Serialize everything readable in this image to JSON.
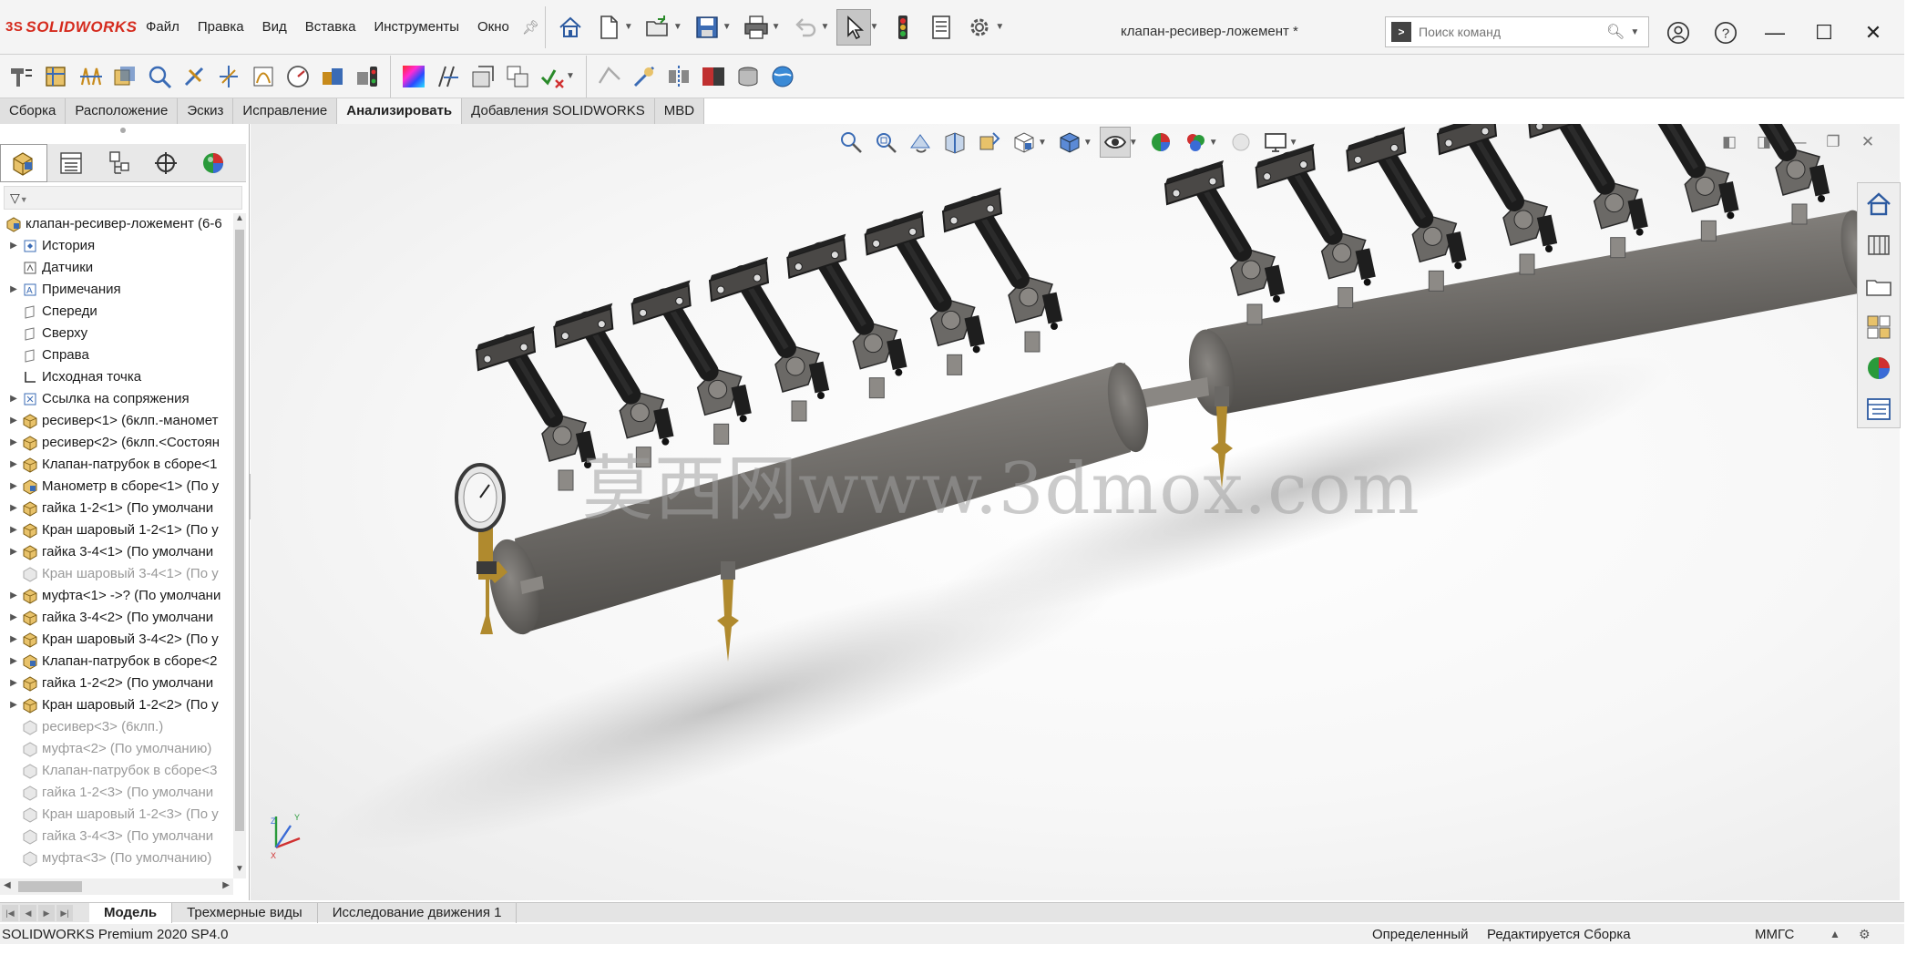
{
  "app": {
    "logo_text": "SOLIDWORKS",
    "logo_prefix": "3S",
    "document_title": "клапан-ресивер-ложемент *"
  },
  "menu": [
    "Файл",
    "Правка",
    "Вид",
    "Вставка",
    "Инструменты",
    "Окно"
  ],
  "search": {
    "placeholder": "Поиск команд"
  },
  "command_tabs": [
    {
      "label": "Сборка",
      "active": false
    },
    {
      "label": "Расположение",
      "active": false
    },
    {
      "label": "Эскиз",
      "active": false
    },
    {
      "label": "Исправление",
      "active": false
    },
    {
      "label": "Анализировать",
      "active": true
    },
    {
      "label": "Добавления SOLIDWORKS",
      "active": false
    },
    {
      "label": "MBD",
      "active": false
    }
  ],
  "feature_tree": {
    "root": "клапан-ресивер-ложемент  (6-6",
    "items": [
      {
        "label": "История",
        "icon": "history-icon",
        "expandable": true,
        "suppressed": false
      },
      {
        "label": "Датчики",
        "icon": "sensor-icon",
        "expandable": false,
        "suppressed": false
      },
      {
        "label": "Примечания",
        "icon": "annotations-icon",
        "expandable": true,
        "suppressed": false
      },
      {
        "label": "Спереди",
        "icon": "plane-icon",
        "expandable": false,
        "suppressed": false
      },
      {
        "label": "Сверху",
        "icon": "plane-icon",
        "expandable": false,
        "suppressed": false
      },
      {
        "label": "Справа",
        "icon": "plane-icon",
        "expandable": false,
        "suppressed": false
      },
      {
        "label": "Исходная точка",
        "icon": "origin-icon",
        "expandable": false,
        "suppressed": false
      },
      {
        "label": "Ссылка на сопряжения",
        "icon": "mate-reference-icon",
        "expandable": true,
        "suppressed": false
      },
      {
        "label": "ресивер<1> (6клп.-маномет",
        "icon": "subassembly-icon",
        "expandable": true,
        "suppressed": false
      },
      {
        "label": "ресивер<2> (6клп.<Состоян",
        "icon": "subassembly-icon",
        "expandable": true,
        "suppressed": false
      },
      {
        "label": "Клапан-патрубок в сборе<1",
        "icon": "subassembly-icon",
        "expandable": true,
        "suppressed": false
      },
      {
        "label": "Манометр в сборе<1> (По у",
        "icon": "subassembly-blue-icon",
        "expandable": true,
        "suppressed": false
      },
      {
        "label": "гайка 1-2<1> (По умолчани",
        "icon": "subassembly-icon",
        "expandable": true,
        "suppressed": false
      },
      {
        "label": "Кран шаровый 1-2<1> (По у",
        "icon": "subassembly-icon",
        "expandable": true,
        "suppressed": false
      },
      {
        "label": "гайка 3-4<1> (По умолчани",
        "icon": "subassembly-icon",
        "expandable": true,
        "suppressed": false
      },
      {
        "label": "Кран шаровый 3-4<1> (По у",
        "icon": "suppressed-icon",
        "expandable": false,
        "suppressed": true
      },
      {
        "label": "муфта<1> ->? (По умолчани",
        "icon": "subassembly-icon",
        "expandable": true,
        "suppressed": false
      },
      {
        "label": "гайка 3-4<2> (По умолчани",
        "icon": "subassembly-icon",
        "expandable": true,
        "suppressed": false
      },
      {
        "label": "Кран шаровый 3-4<2> (По у",
        "icon": "subassembly-icon",
        "expandable": true,
        "suppressed": false
      },
      {
        "label": "Клапан-патрубок в сборе<2",
        "icon": "subassembly-blue-icon",
        "expandable": true,
        "suppressed": false
      },
      {
        "label": "гайка 1-2<2> (По умолчани",
        "icon": "subassembly-icon",
        "expandable": true,
        "suppressed": false
      },
      {
        "label": "Кран шаровый 1-2<2> (По у",
        "icon": "subassembly-icon",
        "expandable": true,
        "suppressed": false
      },
      {
        "label": "ресивер<3> (6клп.)",
        "icon": "suppressed-icon",
        "expandable": false,
        "suppressed": true
      },
      {
        "label": "муфта<2> (По умолчанию)",
        "icon": "suppressed-icon",
        "expandable": false,
        "suppressed": true
      },
      {
        "label": "Клапан-патрубок в сборе<3",
        "icon": "suppressed-icon",
        "expandable": false,
        "suppressed": true
      },
      {
        "label": "гайка 1-2<3> (По умолчани",
        "icon": "suppressed-icon",
        "expandable": false,
        "suppressed": true
      },
      {
        "label": "Кран шаровый 1-2<3> (По у",
        "icon": "suppressed-icon",
        "expandable": false,
        "suppressed": true
      },
      {
        "label": "гайка 3-4<3> (По умолчани",
        "icon": "suppressed-icon",
        "expandable": false,
        "suppressed": true
      },
      {
        "label": "муфта<3> (По умолчанию)",
        "icon": "suppressed-icon",
        "expandable": false,
        "suppressed": true
      }
    ]
  },
  "viewport": {
    "watermark": "莫西网www.3dmox.com"
  },
  "bottom_tabs": [
    {
      "label": "Модель",
      "active": true
    },
    {
      "label": "Трехмерные виды",
      "active": false
    },
    {
      "label": "Исследование движения 1",
      "active": false
    }
  ],
  "status": {
    "version": "SOLIDWORKS Premium 2020 SP4.0",
    "definition": "Определенный",
    "mode": "Редактируется Сборка",
    "units": "ММГС"
  },
  "colors": {
    "logo_red": "#d52b1e",
    "toolbar_bg": "#f4f4f4",
    "pipe_gray": "#7d7a76",
    "valve_dark": "#222222",
    "fitting_brass": "#b08a2e"
  }
}
